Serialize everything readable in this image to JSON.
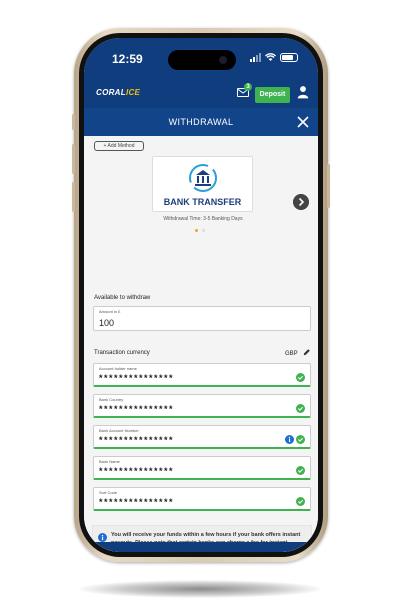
{
  "status_bar": {
    "time": "12:59"
  },
  "header": {
    "logo_text": "CORAL",
    "logo_accent": "ICE",
    "mail_badge": "3",
    "deposit_label": "Deposit"
  },
  "title_bar": {
    "title": "WITHDRAWAL"
  },
  "methods": {
    "add_label": "+ Add Method",
    "card_label": "BANK TRANSFER",
    "card_sub": "Withdrawal Time: 3-5 Banking Days"
  },
  "available": {
    "label": "Available to withdraw",
    "amount_label": "Amount in £",
    "amount_value": "100"
  },
  "currency": {
    "label": "Transaction currency",
    "value": "GBP"
  },
  "fields": [
    {
      "label": "Account holder name",
      "value": "***************",
      "icons": [
        "check-icon"
      ]
    },
    {
      "label": "Bank Country",
      "value": "***************",
      "icons": [
        "check-icon"
      ]
    },
    {
      "label": "Bank Account Number",
      "value": "***************",
      "icons": [
        "info-icon",
        "check-icon"
      ]
    },
    {
      "label": "Bank Name",
      "value": "***************",
      "icons": [
        "check-icon"
      ]
    },
    {
      "label": "Sort Code",
      "value": "***************",
      "icons": [
        "check-icon"
      ]
    }
  ],
  "notice": {
    "text": "You will receive your funds within a few hours if your bank offers instant payouts. Please note that certain banks can charge a fee for instant payouts."
  },
  "colors": {
    "brand_blue": "#0f3d7e",
    "accent_green": "#3fb34f",
    "logo_yellow": "#f2c200"
  }
}
